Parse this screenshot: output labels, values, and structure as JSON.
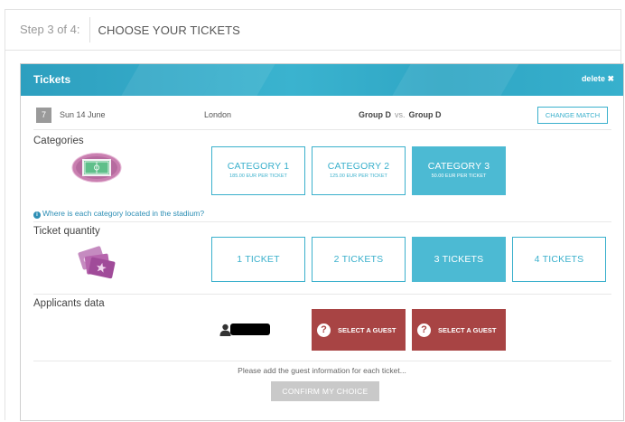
{
  "step": {
    "number_text": "Step 3 of 4:",
    "title": "CHOOSE YOUR TICKETS"
  },
  "panel": {
    "title": "Tickets",
    "delete_label": "delete ✖"
  },
  "match": {
    "badge": "7",
    "date": "Sun 14 June",
    "city": "London",
    "home": "Group D",
    "vs": "vs.",
    "away": "Group D",
    "change_label": "CHANGE MATCH"
  },
  "categories": {
    "label": "Categories",
    "items": [
      {
        "title": "CATEGORY 1",
        "price": "185.00 EUR PER TICKET",
        "selected": false
      },
      {
        "title": "CATEGORY 2",
        "price": "125.00 EUR PER TICKET",
        "selected": false
      },
      {
        "title": "CATEGORY 3",
        "price": "50.00 EUR PER TICKET",
        "selected": true
      }
    ],
    "info_icon": "i",
    "info_link": "Where is each category located in the stadium?"
  },
  "quantity": {
    "label": "Ticket quantity",
    "options": [
      {
        "label": "1 TICKET",
        "selected": false
      },
      {
        "label": "2 TICKETS",
        "selected": false
      },
      {
        "label": "3 TICKETS",
        "selected": true
      },
      {
        "label": "4 TICKETS",
        "selected": false
      }
    ]
  },
  "applicants": {
    "label": "Applicants data",
    "guest_buttons": [
      {
        "icon": "?",
        "label": "SELECT A GUEST"
      },
      {
        "icon": "?",
        "label": "SELECT A GUEST"
      }
    ]
  },
  "footer": {
    "help_text": "Please add the guest information for each ticket...",
    "confirm_label": "CONFIRM MY CHOICE"
  },
  "colors": {
    "accent": "#3ab0cc",
    "selected_fill": "#4cbad3",
    "guest_button": "#a84444",
    "disabled": "#c9c9c9",
    "stadium": "#c97fb0",
    "tickets": "#a84b9c"
  },
  "icons": [
    "stadium-icon",
    "tickets-icon",
    "user-icon",
    "info-icon",
    "question-icon",
    "close-icon"
  ]
}
